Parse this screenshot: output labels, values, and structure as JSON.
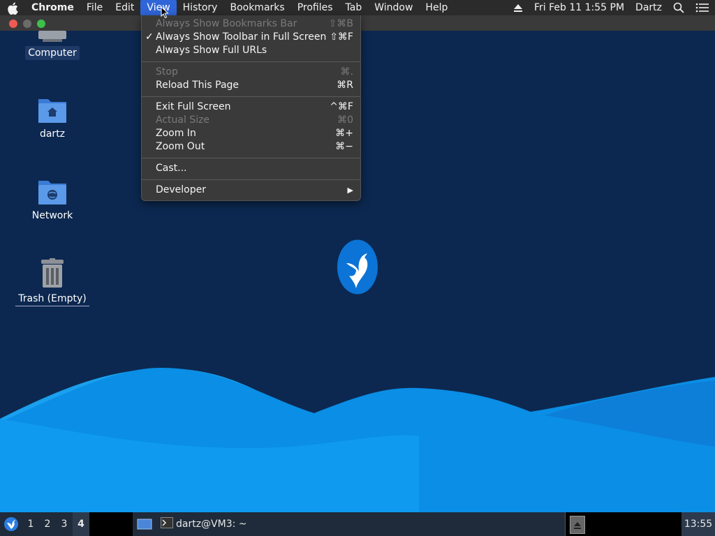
{
  "menubar": {
    "app": "Chrome",
    "menus": [
      "File",
      "Edit",
      "View",
      "History",
      "Bookmarks",
      "Profiles",
      "Tab",
      "Window",
      "Help"
    ],
    "active_menu": "View",
    "datetime": "Fri Feb 11  1:55 PM",
    "user": "Dartz",
    "icons": [
      "apple-icon",
      "eject-icon",
      "spotlight-search-icon",
      "notification-list-icon"
    ]
  },
  "desktop": {
    "icons": [
      {
        "label": "Computer",
        "icon": "computer-icon"
      },
      {
        "label": "dartz",
        "icon": "home-folder-icon"
      },
      {
        "label": "Network",
        "icon": "network-folder-icon"
      },
      {
        "label": "Trash (Empty)",
        "icon": "trash-icon"
      }
    ]
  },
  "view_menu": {
    "items": [
      {
        "label": "Always Show Bookmarks Bar",
        "shortcut": "⇧⌘B",
        "disabled": true,
        "checked": false
      },
      {
        "label": "Always Show Toolbar in Full Screen",
        "shortcut": "⇧⌘F",
        "disabled": false,
        "checked": true
      },
      {
        "label": "Always Show Full URLs",
        "shortcut": "",
        "disabled": false,
        "checked": false
      },
      {
        "label": "Stop",
        "shortcut": "⌘.",
        "disabled": true,
        "checked": false
      },
      {
        "label": "Reload This Page",
        "shortcut": "⌘R",
        "disabled": false,
        "checked": false
      },
      {
        "label": "Exit Full Screen",
        "shortcut": "^⌘F",
        "disabled": false,
        "checked": false
      },
      {
        "label": "Actual Size",
        "shortcut": "⌘0",
        "disabled": true,
        "checked": false
      },
      {
        "label": "Zoom In",
        "shortcut": "⌘+",
        "disabled": false,
        "checked": false
      },
      {
        "label": "Zoom Out",
        "shortcut": "⌘−",
        "disabled": false,
        "checked": false
      },
      {
        "label": "Cast...",
        "shortcut": "",
        "disabled": false,
        "checked": false
      },
      {
        "label": "Developer",
        "shortcut": "▶",
        "disabled": false,
        "checked": false
      }
    ],
    "check_mark": "✓"
  },
  "taskbar": {
    "workspaces": [
      "1",
      "2",
      "3",
      "4"
    ],
    "current_workspace": "4",
    "task_label": "dartz@VM3: ~",
    "clock": "13:55"
  },
  "colors": {
    "desktop_bg": "#0c2850",
    "wave_light": "#10a8f0",
    "wave_mid": "#0a8ee6",
    "menu_highlight": "#2f65d8"
  }
}
